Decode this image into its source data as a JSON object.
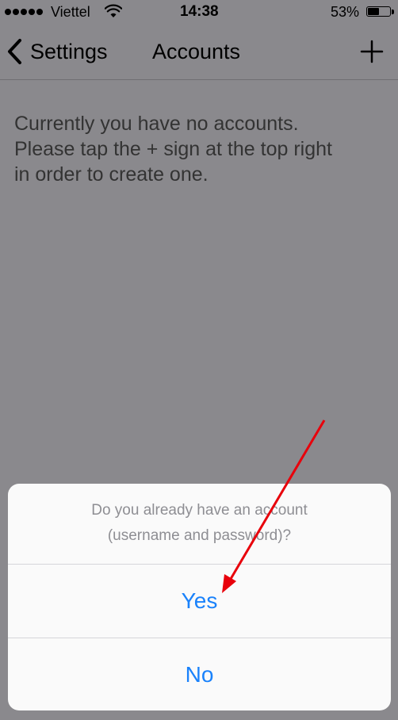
{
  "status_bar": {
    "carrier": "Viettel",
    "signal_bars": 5,
    "time": "14:38",
    "battery_percent": "53%",
    "battery_level": 0.53,
    "icons": [
      "signal-dots-icon",
      "wifi-icon",
      "battery-icon"
    ]
  },
  "nav": {
    "back_label": "Settings",
    "title": "Accounts",
    "icons": [
      "chevron-left-icon",
      "plus-icon"
    ]
  },
  "main": {
    "empty_message": "Currently you have no accounts.\nPlease tap the + sign at the top right\nin order to create one."
  },
  "action_sheet": {
    "message": "Do you already have an account\n(username and password)?",
    "options": [
      "Yes",
      "No"
    ]
  },
  "colors": {
    "dimmed_background": "#8a898d",
    "action_tint": "#1a82fb",
    "annotation_arrow": "#e8000b"
  }
}
